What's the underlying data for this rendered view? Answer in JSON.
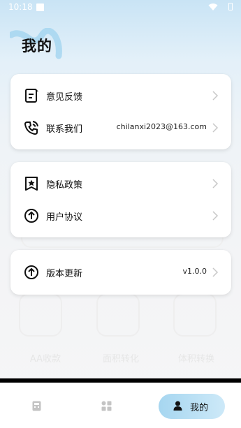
{
  "status_bar": {
    "time": "10:18"
  },
  "header": {
    "title": "我的"
  },
  "background": {
    "tiles": [
      "AA收款",
      "面积转化",
      "体积转换"
    ]
  },
  "cards": [
    {
      "items": [
        {
          "label": "意见反馈",
          "value": "",
          "icon": "feedback-icon"
        },
        {
          "label": "联系我们",
          "value": "chilanxi2023@163.com",
          "icon": "phone-icon"
        }
      ]
    },
    {
      "items": [
        {
          "label": "隐私政策",
          "value": "",
          "icon": "privacy-star-icon"
        },
        {
          "label": "用户协议",
          "value": "",
          "icon": "agreement-arrow-icon"
        }
      ]
    },
    {
      "items": [
        {
          "label": "版本更新",
          "value": "v1.0.0",
          "icon": "update-arrow-icon"
        }
      ]
    }
  ],
  "tabbar": {
    "tabs": [
      {
        "label": "",
        "icon": "calculator-icon"
      },
      {
        "label": "",
        "icon": "apps-icon"
      },
      {
        "label": "我的",
        "icon": "user-icon"
      }
    ]
  },
  "colors": {
    "accent": "#a6d6f0",
    "background_top": "#c9e4f5"
  }
}
